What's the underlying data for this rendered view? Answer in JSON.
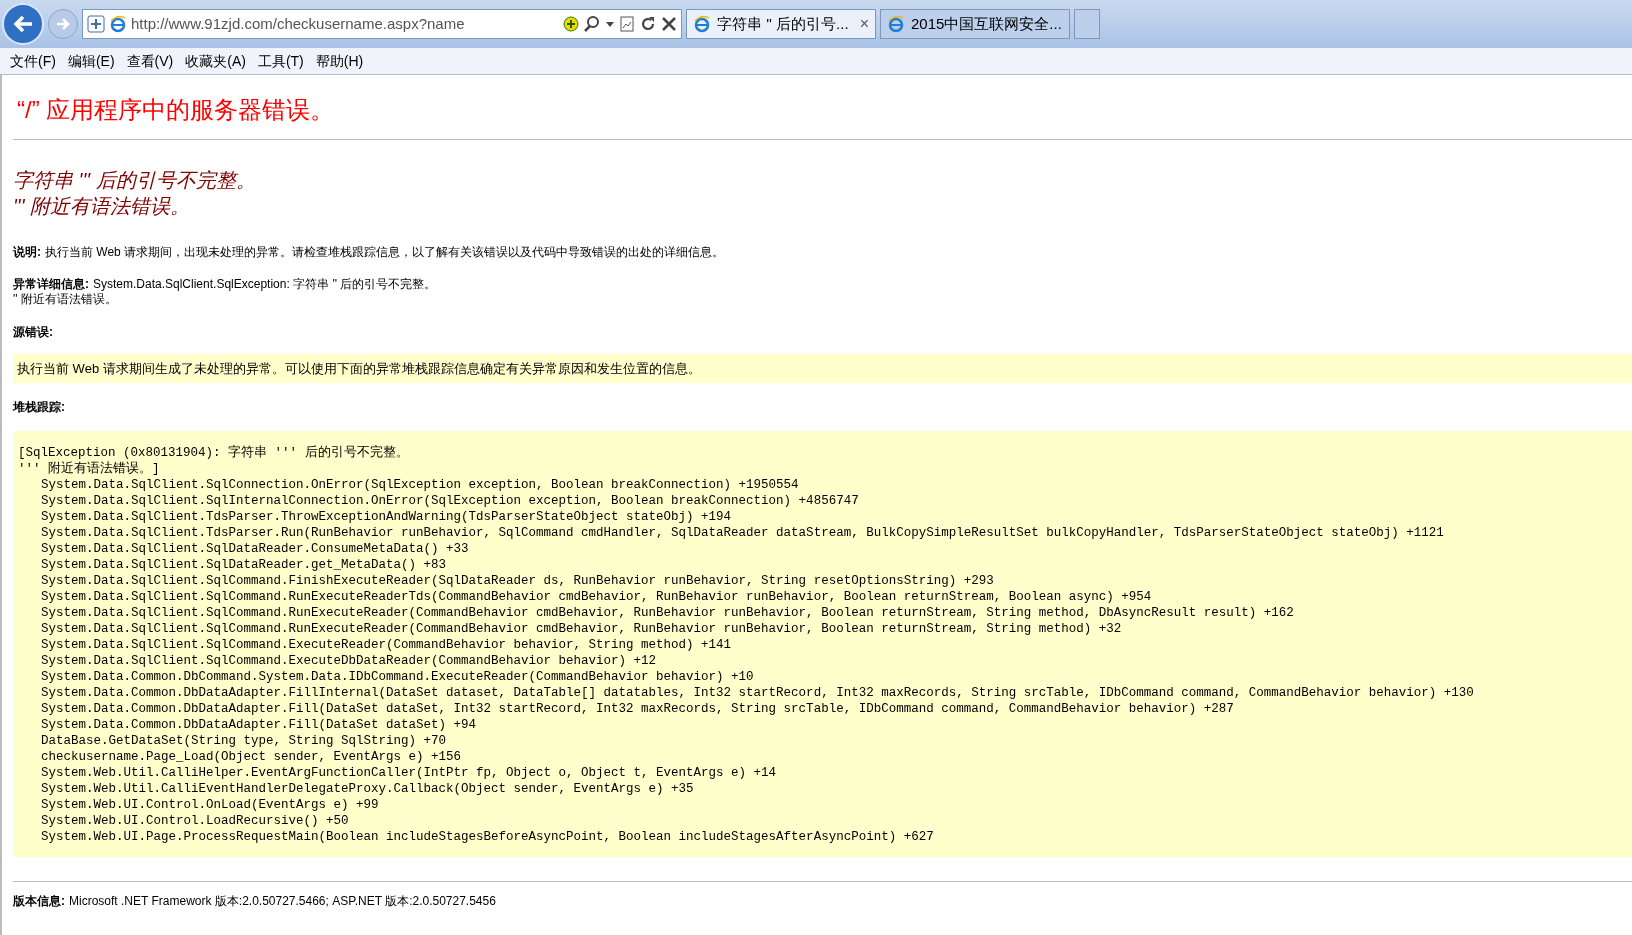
{
  "browser": {
    "address": "http://www.91zjd.com/checkusername.aspx?name",
    "tabs": [
      {
        "title": "字符串 '' 后的引号...",
        "selected": true,
        "close": "×"
      },
      {
        "title": "2015中国互联网安全...",
        "selected": false
      }
    ],
    "menu": [
      "文件(F)",
      "编辑(E)",
      "查看(V)",
      "收藏夹(A)",
      "工具(T)",
      "帮助(H)"
    ]
  },
  "page": {
    "title": "“/” 应用程序中的服务器错误。",
    "error_heading": [
      "字符串 ''' 后的引号不完整。",
      "''' 附近有语法错误。"
    ],
    "description": {
      "label": "说明:",
      "text": "执行当前 Web 请求期间，出现未处理的异常。请检查堆栈跟踪信息，以了解有关该错误以及代码中导致错误的出处的详细信息。"
    },
    "exception_details": {
      "label": "异常详细信息:",
      "lines": [
        "System.Data.SqlClient.SqlException: 字符串 '' 后的引号不完整。",
        "'' 附近有语法错误。"
      ]
    },
    "source_error": {
      "label": "源错误:",
      "text": "执行当前 Web 请求期间生成了未处理的异常。可以使用下面的异常堆栈跟踪信息确定有关异常原因和发生位置的信息。"
    },
    "stack_trace": {
      "label": "堆栈跟踪:",
      "header": [
        "[SqlException (0x80131904): 字符串 ''' 后的引号不完整。",
        "''' 附近有语法错误。]"
      ],
      "frames": [
        "System.Data.SqlClient.SqlConnection.OnError(SqlException exception, Boolean breakConnection) +1950554",
        "System.Data.SqlClient.SqlInternalConnection.OnError(SqlException exception, Boolean breakConnection) +4856747",
        "System.Data.SqlClient.TdsParser.ThrowExceptionAndWarning(TdsParserStateObject stateObj) +194",
        "System.Data.SqlClient.TdsParser.Run(RunBehavior runBehavior, SqlCommand cmdHandler, SqlDataReader dataStream, BulkCopySimpleResultSet bulkCopyHandler, TdsParserStateObject stateObj) +1121",
        "System.Data.SqlClient.SqlDataReader.ConsumeMetaData() +33",
        "System.Data.SqlClient.SqlDataReader.get_MetaData() +83",
        "System.Data.SqlClient.SqlCommand.FinishExecuteReader(SqlDataReader ds, RunBehavior runBehavior, String resetOptionsString) +293",
        "System.Data.SqlClient.SqlCommand.RunExecuteReaderTds(CommandBehavior cmdBehavior, RunBehavior runBehavior, Boolean returnStream, Boolean async) +954",
        "System.Data.SqlClient.SqlCommand.RunExecuteReader(CommandBehavior cmdBehavior, RunBehavior runBehavior, Boolean returnStream, String method, DbAsyncResult result) +162",
        "System.Data.SqlClient.SqlCommand.RunExecuteReader(CommandBehavior cmdBehavior, RunBehavior runBehavior, Boolean returnStream, String method) +32",
        "System.Data.SqlClient.SqlCommand.ExecuteReader(CommandBehavior behavior, String method) +141",
        "System.Data.SqlClient.SqlCommand.ExecuteDbDataReader(CommandBehavior behavior) +12",
        "System.Data.Common.DbCommand.System.Data.IDbCommand.ExecuteReader(CommandBehavior behavior) +10",
        "System.Data.Common.DbDataAdapter.FillInternal(DataSet dataset, DataTable[] datatables, Int32 startRecord, Int32 maxRecords, String srcTable, IDbCommand command, CommandBehavior behavior) +130",
        "System.Data.Common.DbDataAdapter.Fill(DataSet dataSet, Int32 startRecord, Int32 maxRecords, String srcTable, IDbCommand command, CommandBehavior behavior) +287",
        "System.Data.Common.DbDataAdapter.Fill(DataSet dataSet) +94",
        "DataBase.GetDataSet(String type, String SqlString) +70",
        "checkusername.Page_Load(Object sender, EventArgs e) +156",
        "System.Web.Util.CalliHelper.EventArgFunctionCaller(IntPtr fp, Object o, Object t, EventArgs e) +14",
        "System.Web.Util.CalliEventHandlerDelegateProxy.Callback(Object sender, EventArgs e) +35",
        "System.Web.UI.Control.OnLoad(EventArgs e) +99",
        "System.Web.UI.Control.LoadRecursive() +50",
        "System.Web.UI.Page.ProcessRequestMain(Boolean includeStagesBeforeAsyncPoint, Boolean includeStagesAfterAsyncPoint) +627"
      ]
    },
    "version": {
      "label": "版本信息:",
      "text": "Microsoft .NET Framework 版本:2.0.50727.5466; ASP.NET 版本:2.0.50727.5456"
    }
  }
}
